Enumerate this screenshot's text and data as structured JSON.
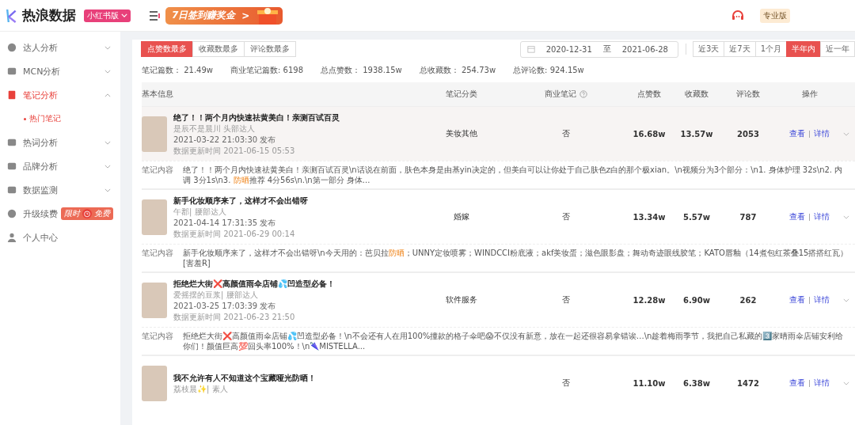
{
  "header": {
    "brand": "热浪数据",
    "edition": "小红书版",
    "promo": "7日签到赚奖金",
    "promo_arrow": ">",
    "plan": "专业版"
  },
  "sidebar": {
    "items": [
      {
        "label": "达人分析",
        "expanded": false,
        "selected": false
      },
      {
        "label": "MCN分析",
        "expanded": false,
        "selected": false
      },
      {
        "label": "笔记分析",
        "expanded": true,
        "selected": true,
        "children": [
          {
            "label": "热门笔记",
            "selected": true
          }
        ]
      },
      {
        "label": "热词分析",
        "expanded": false,
        "selected": false
      },
      {
        "label": "品牌分析",
        "expanded": false,
        "selected": false
      },
      {
        "label": "数据监测",
        "expanded": false,
        "selected": false
      },
      {
        "label": "升级续费",
        "selected": false,
        "badge": [
          "限时",
          "免费"
        ]
      },
      {
        "label": "个人中心",
        "selected": false
      }
    ]
  },
  "sort_tabs": [
    {
      "label": "点赞数最多",
      "selected": true
    },
    {
      "label": "收藏数最多",
      "selected": false
    },
    {
      "label": "评论数最多",
      "selected": false
    }
  ],
  "date_range": {
    "start": "2020-12-31",
    "separator": "至",
    "end": "2021-06-28"
  },
  "range_tabs": [
    {
      "label": "近3天",
      "selected": false
    },
    {
      "label": "近7天",
      "selected": false
    },
    {
      "label": "1个月",
      "selected": false
    },
    {
      "label": "半年内",
      "selected": true
    },
    {
      "label": "近一年",
      "selected": false
    }
  ],
  "stats": [
    {
      "label": "笔记篇数：",
      "value": "21.49w"
    },
    {
      "label": "商业笔记篇数:",
      "value": "6198"
    },
    {
      "label": "总点赞数：",
      "value": "1938.15w"
    },
    {
      "label": "总收藏数：",
      "value": "254.73w"
    },
    {
      "label": "总评论数:",
      "value": "924.15w"
    }
  ],
  "table": {
    "columns": [
      "基本信息",
      "笔记分类",
      "商业笔记",
      "点赞数",
      "收藏数",
      "评论数",
      "操作"
    ],
    "rows": [
      {
        "selected": true,
        "title": "绝了！！两个月内快速祛黄美白！亲测百试百灵",
        "author": "是辰不是晨川 头部达人",
        "published": "2021-03-22 21:03:30 发布",
        "updated_label": "数据更新时间",
        "updated": "2021-06-15 05:53",
        "category": "美妆其他",
        "business": "否",
        "likes": "16.68w",
        "favorites": "13.57w",
        "comments": "2053",
        "actions": [
          "查看",
          "详情"
        ],
        "content_label": "笔记内容",
        "content": [
          {
            "text": "绝了！！两个月内快速祛黄美白！亲测百试百灵\\n话说在前面，肤色本身是由基yin决定的，但美白可以让你处于自己肤色z白的那个极xian。\\n视频分为3个部分：\\n1. 身体护理 32s\\n2. 内调 3分1s\\n3. ",
            "highlight": false
          },
          {
            "text": "防晒",
            "highlight": true
          },
          {
            "text": "推荐 4分56s\\n.\\n第一部分 身体...",
            "highlight": false
          }
        ]
      },
      {
        "selected": false,
        "title": "新手化妆顺序来了，这样才不会出错呀",
        "author": "午郡| 腰部达人",
        "published": "2021-04-14 17:31:35 发布",
        "updated_label": "数据更新时间",
        "updated": "2021-06-29 00:14",
        "category": "婚嫁",
        "business": "否",
        "likes": "13.34w",
        "favorites": "5.57w",
        "comments": "787",
        "actions": [
          "查看",
          "详情"
        ],
        "content_label": "笔记内容",
        "content": [
          {
            "text": "新手化妆顺序来了，这样才不会出错呀\\n今天用的：芭贝拉",
            "highlight": false
          },
          {
            "text": "防晒",
            "highlight": true
          },
          {
            "text": "；UNNY定妆喷雾；WINDCCI粉底液；akf美妆蛋；滋色眼影盘；舞动奇迹眼线胶笔；KATO唇釉（14煮包红茶叠15搭搭红瓦）[害羞R]",
            "highlight": false
          }
        ]
      },
      {
        "selected": false,
        "title": "拒绝烂大街❌高颜值雨伞店铺💦凹造型必备！",
        "author": "爱摇摆的豆浆| 腰部达人",
        "published": "2021-03-25 17:03:39 发布",
        "updated_label": "数据更新时间",
        "updated": "2021-06-23 21:50",
        "category": "软件服务",
        "business": "否",
        "likes": "12.28w",
        "favorites": "6.90w",
        "comments": "262",
        "actions": [
          "查看",
          "详情"
        ],
        "content_label": "笔记内容",
        "content": [
          {
            "text": "拒绝烂大街❌高颜值雨伞店铺💦凹造型必备！\\n不会还有人在用100%撞款的格子伞吧😱不仅没有新意，放在一起还很容易拿错诶…\\n趁着梅雨季节，我把自己私藏的3️⃣家晴雨伞店铺安利给你们！颜值巨高💯回头率100%！\\n🌂MISTELLA...",
            "highlight": false
          }
        ]
      },
      {
        "selected": false,
        "title": "我不允许有人不知道这个宝藏哑光防晒！",
        "author": "荔枝晨✨| 素人",
        "likes": "11.10w",
        "favorites": "6.38w",
        "comments": "1472",
        "business": "否",
        "actions": [
          "查看",
          "详情"
        ]
      }
    ]
  }
}
